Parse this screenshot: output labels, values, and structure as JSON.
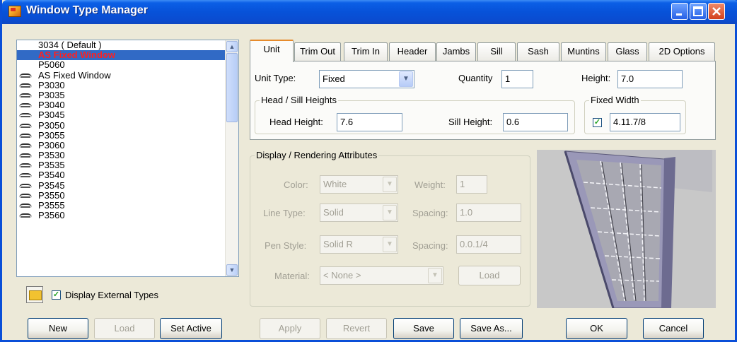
{
  "window": {
    "title": "Window Type Manager"
  },
  "list": {
    "items": [
      {
        "label": "3034 ( Default )",
        "icon": "none",
        "selected": false
      },
      {
        "label": "AS Fixed Window",
        "icon": "none",
        "selected": true
      },
      {
        "label": "P5060",
        "icon": "none",
        "selected": false
      },
      {
        "label": "AS Fixed Window",
        "icon": "external-type-icon",
        "selected": false
      },
      {
        "label": "P3030",
        "icon": "external-type-icon",
        "selected": false
      },
      {
        "label": "P3035",
        "icon": "external-type-icon",
        "selected": false
      },
      {
        "label": "P3040",
        "icon": "external-type-icon",
        "selected": false
      },
      {
        "label": "P3045",
        "icon": "external-type-icon",
        "selected": false
      },
      {
        "label": "P3050",
        "icon": "external-type-icon",
        "selected": false
      },
      {
        "label": "P3055",
        "icon": "external-type-icon",
        "selected": false
      },
      {
        "label": "P3060",
        "icon": "external-type-icon",
        "selected": false
      },
      {
        "label": "P3530",
        "icon": "external-type-icon",
        "selected": false
      },
      {
        "label": "P3535",
        "icon": "external-type-icon",
        "selected": false
      },
      {
        "label": "P3540",
        "icon": "external-type-icon",
        "selected": false
      },
      {
        "label": "P3545",
        "icon": "external-type-icon",
        "selected": false
      },
      {
        "label": "P3550",
        "icon": "external-type-icon",
        "selected": false
      },
      {
        "label": "P3555",
        "icon": "external-type-icon",
        "selected": false
      },
      {
        "label": "P3560",
        "icon": "external-type-icon",
        "selected": false
      }
    ]
  },
  "display_external": {
    "label": "Display External Types",
    "checked": true
  },
  "left_buttons": {
    "new": "New",
    "load": "Load",
    "set_active": "Set Active"
  },
  "tabs": [
    {
      "label": "Unit",
      "active": true
    },
    {
      "label": "Trim Out",
      "active": false
    },
    {
      "label": "Trim In",
      "active": false
    },
    {
      "label": "Header",
      "active": false
    },
    {
      "label": "Jambs",
      "active": false
    },
    {
      "label": "Sill",
      "active": false
    },
    {
      "label": "Sash",
      "active": false
    },
    {
      "label": "Muntins",
      "active": false
    },
    {
      "label": "Glass",
      "active": false
    },
    {
      "label": "2D Options",
      "active": false
    }
  ],
  "unit": {
    "unit_type_label": "Unit Type:",
    "unit_type_value": "Fixed",
    "quantity_label": "Quantity",
    "quantity_value": "1",
    "height_label": "Height:",
    "height_value": "7.0",
    "head_sill_title": "Head / Sill Heights",
    "head_height_label": "Head Height:",
    "head_height_value": "7.6",
    "sill_height_label": "Sill Height:",
    "sill_height_value": "0.6",
    "fixed_width_title": "Fixed Width",
    "fixed_width_checked": true,
    "fixed_width_value": "4.11.7/8"
  },
  "display": {
    "title": "Display / Rendering Attributes",
    "color_label": "Color:",
    "color_value": "White",
    "weight_label": "Weight:",
    "weight_value": "1",
    "line_type_label": "Line Type:",
    "line_type_value": "Solid",
    "spacing1_label": "Spacing:",
    "spacing1_value": "1.0",
    "pen_style_label": "Pen Style:",
    "pen_style_value": "Solid R",
    "spacing2_label": "Spacing:",
    "spacing2_value": "0.0.1/4",
    "material_label": "Material:",
    "material_value": "< None >",
    "load_label": "Load"
  },
  "bottom_buttons": {
    "apply": "Apply",
    "revert": "Revert",
    "save": "Save",
    "save_as": "Save As...",
    "ok": "OK",
    "cancel": "Cancel"
  },
  "colors": {
    "title_bar": "#0752d9",
    "selection": "#316ac5",
    "selected_text": "#ff2020",
    "face": "#ece9d8"
  }
}
